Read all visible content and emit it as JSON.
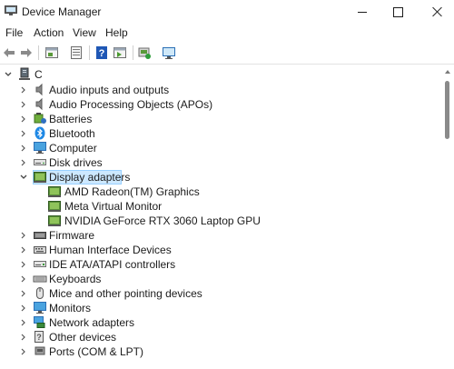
{
  "window": {
    "title": "Device Manager"
  },
  "menu": [
    "File",
    "Action",
    "View",
    "Help"
  ],
  "toolbar": {
    "buttons": [
      "back-arrow-icon",
      "forward-arrow-icon",
      "properties-icon",
      "show-hidden-icon",
      "help-icon",
      "action-pane-icon",
      "update-driver-icon",
      "scan-hardware-icon"
    ]
  },
  "tree": {
    "root": "C",
    "categories": [
      "Audio inputs and outputs",
      "Audio Processing Objects (APOs)",
      "Batteries",
      "Bluetooth",
      "Computer",
      "Disk drives",
      "Display adapters",
      "Firmware",
      "Human Interface Devices",
      "IDE ATA/ATAPI controllers",
      "Keyboards",
      "Mice and other pointing devices",
      "Monitors",
      "Network adapters",
      "Other devices",
      "Ports (COM & LPT)"
    ],
    "expanded_category": "Display adapters",
    "display_adapters": [
      "AMD Radeon(TM) Graphics",
      "Meta Virtual Monitor",
      "NVIDIA GeForce RTX 3060 Laptop GPU"
    ]
  },
  "colors": {
    "selection": "#cce8ff",
    "selection_border": "#99d1ff",
    "accent": "#1e88e5"
  }
}
